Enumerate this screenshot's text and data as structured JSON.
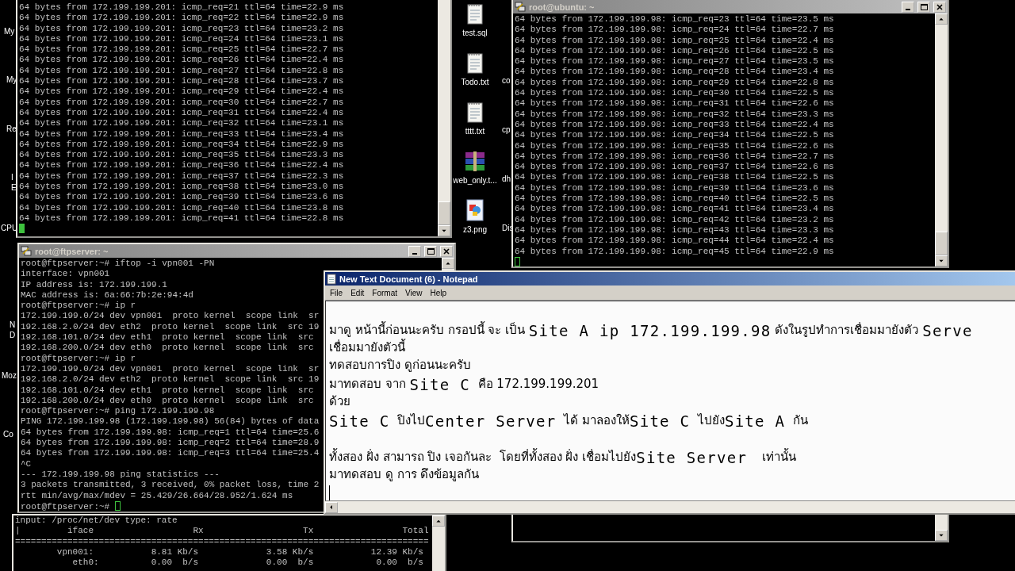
{
  "desktop": {
    "edge_labels": [
      {
        "text": "My"
      },
      {
        "text": "My"
      },
      {
        "text": "Re"
      },
      {
        "text": "I"
      },
      {
        "text": "E"
      },
      {
        "text": "CPU"
      },
      {
        "text": "N"
      },
      {
        "text": "D"
      },
      {
        "text": "Moz"
      },
      {
        "text": "Co"
      }
    ],
    "icons": [
      {
        "label": "test.sql",
        "kind": "text"
      },
      {
        "label": "Todo.txt",
        "kind": "text"
      },
      {
        "label": "tttt.txt",
        "kind": "text"
      },
      {
        "label": "web_only.t...",
        "kind": "archive"
      },
      {
        "label": "z3.png",
        "kind": "image"
      }
    ],
    "cut_labels": [
      "co",
      "cp",
      "dh",
      "Dis"
    ]
  },
  "top_left_terminal": {
    "lines": [
      "64 bytes from 172.199.199.201: icmp_req=21 ttl=64 time=22.9 ms",
      "64 bytes from 172.199.199.201: icmp_req=22 ttl=64 time=22.9 ms",
      "64 bytes from 172.199.199.201: icmp_req=23 ttl=64 time=23.2 ms",
      "64 bytes from 172.199.199.201: icmp_req=24 ttl=64 time=23.1 ms",
      "64 bytes from 172.199.199.201: icmp_req=25 ttl=64 time=22.7 ms",
      "64 bytes from 172.199.199.201: icmp_req=26 ttl=64 time=22.4 ms",
      "64 bytes from 172.199.199.201: icmp_req=27 ttl=64 time=22.8 ms",
      "64 bytes from 172.199.199.201: icmp_req=28 ttl=64 time=23.7 ms",
      "64 bytes from 172.199.199.201: icmp_req=29 ttl=64 time=22.4 ms",
      "64 bytes from 172.199.199.201: icmp_req=30 ttl=64 time=22.7 ms",
      "64 bytes from 172.199.199.201: icmp_req=31 ttl=64 time=22.4 ms",
      "64 bytes from 172.199.199.201: icmp_req=32 ttl=64 time=23.1 ms",
      "64 bytes from 172.199.199.201: icmp_req=33 ttl=64 time=23.4 ms",
      "64 bytes from 172.199.199.201: icmp_req=34 ttl=64 time=22.9 ms",
      "64 bytes from 172.199.199.201: icmp_req=35 ttl=64 time=23.3 ms",
      "64 bytes from 172.199.199.201: icmp_req=36 ttl=64 time=22.4 ms",
      "64 bytes from 172.199.199.201: icmp_req=37 ttl=64 time=22.3 ms",
      "64 bytes from 172.199.199.201: icmp_req=38 ttl=64 time=23.0 ms",
      "64 bytes from 172.199.199.201: icmp_req=39 ttl=64 time=23.6 ms",
      "64 bytes from 172.199.199.201: icmp_req=40 ttl=64 time=23.8 ms",
      "64 bytes from 172.199.199.201: icmp_req=41 ttl=64 time=22.8 ms"
    ]
  },
  "ubuntu_terminal": {
    "title": "root@ubuntu: ~",
    "lines": [
      "64 bytes from 172.199.199.98: icmp_req=23 ttl=64 time=23.5 ms",
      "64 bytes from 172.199.199.98: icmp_req=24 ttl=64 time=22.7 ms",
      "64 bytes from 172.199.199.98: icmp_req=25 ttl=64 time=22.4 ms",
      "64 bytes from 172.199.199.98: icmp_req=26 ttl=64 time=22.5 ms",
      "64 bytes from 172.199.199.98: icmp_req=27 ttl=64 time=23.5 ms",
      "64 bytes from 172.199.199.98: icmp_req=28 ttl=64 time=23.4 ms",
      "64 bytes from 172.199.199.98: icmp_req=29 ttl=64 time=22.8 ms",
      "64 bytes from 172.199.199.98: icmp_req=30 ttl=64 time=22.5 ms",
      "64 bytes from 172.199.199.98: icmp_req=31 ttl=64 time=22.6 ms",
      "64 bytes from 172.199.199.98: icmp_req=32 ttl=64 time=23.3 ms",
      "64 bytes from 172.199.199.98: icmp_req=33 ttl=64 time=22.4 ms",
      "64 bytes from 172.199.199.98: icmp_req=34 ttl=64 time=22.5 ms",
      "64 bytes from 172.199.199.98: icmp_req=35 ttl=64 time=22.6 ms",
      "64 bytes from 172.199.199.98: icmp_req=36 ttl=64 time=22.7 ms",
      "64 bytes from 172.199.199.98: icmp_req=37 ttl=64 time=22.6 ms",
      "64 bytes from 172.199.199.98: icmp_req=38 ttl=64 time=22.5 ms",
      "64 bytes from 172.199.199.98: icmp_req=39 ttl=64 time=23.6 ms",
      "64 bytes from 172.199.199.98: icmp_req=40 ttl=64 time=22.5 ms",
      "64 bytes from 172.199.199.98: icmp_req=41 ttl=64 time=23.4 ms",
      "64 bytes from 172.199.199.98: icmp_req=42 ttl=64 time=23.2 ms",
      "64 bytes from 172.199.199.98: icmp_req=43 ttl=64 time=23.3 ms",
      "64 bytes from 172.199.199.98: icmp_req=44 ttl=64 time=22.4 ms",
      "64 bytes from 172.199.199.98: icmp_req=45 ttl=64 time=22.9 ms"
    ]
  },
  "iftop_terminal": {
    "lines": [
      "input: /proc/net/dev type: rate",
      "|         iface                   Rx                   Tx                 Total",
      "===============================================================================",
      "        vpn001:           8.81 Kb/s             3.58 Kb/s           12.39 Kb/s",
      "           eth0:          0.00  b/s             0.00  b/s            0.00  b/s"
    ]
  },
  "ftpserver_terminal": {
    "title": "root@ftpserver: ~",
    "lines": [
      "root@ftpserver:~# iftop -i vpn001 -PN",
      "interface: vpn001",
      "IP address is: 172.199.199.1",
      "MAC address is: 6a:66:7b:2e:94:4d",
      "root@ftpserver:~# ip r",
      "172.199.199.0/24 dev vpn001  proto kernel  scope link  sr",
      "192.168.2.0/24 dev eth2  proto kernel  scope link  src 19",
      "192.168.101.0/24 dev eth1  proto kernel  scope link  src",
      "192.168.200.0/24 dev eth0  proto kernel  scope link  src",
      "root@ftpserver:~# ip r",
      "172.199.199.0/24 dev vpn001  proto kernel  scope link  sr",
      "192.168.2.0/24 dev eth2  proto kernel  scope link  src 19",
      "192.168.101.0/24 dev eth1  proto kernel  scope link  src",
      "192.168.200.0/24 dev eth0  proto kernel  scope link  src",
      "root@ftpserver:~# ping 172.199.199.98",
      "PING 172.199.199.98 (172.199.199.98) 56(84) bytes of data",
      "64 bytes from 172.199.199.98: icmp_req=1 ttl=64 time=25.6",
      "64 bytes from 172.199.199.98: icmp_req=2 ttl=64 time=28.9",
      "64 bytes from 172.199.199.98: icmp_req=3 ttl=64 time=25.4",
      "^C",
      "--- 172.199.199.98 ping statistics ---",
      "3 packets transmitted, 3 received, 0% packet loss, time 2",
      "rtt min/avg/max/mdev = 25.429/26.664/28.952/1.624 ms",
      "root@ftpserver:~# "
    ]
  },
  "notepad": {
    "title": "New Text Document (6) - Notepad",
    "menu": [
      "File",
      "Edit",
      "Format",
      "View",
      "Help"
    ],
    "lines": [
      {
        "kind": "text",
        "segments": [
          {
            "text": "มาดู หน้านี้ก่อนนะครับ กรอปนี้ จะ เป็น ",
            "kind": "thai"
          },
          {
            "text": "Site A ip 172.199.199.98",
            "kind": "mono"
          },
          {
            "text": " ดังในรูปทำการเชื่อมมายังตัว ",
            "kind": "thai"
          },
          {
            "text": "Serve",
            "kind": "mono"
          }
        ]
      },
      {
        "kind": "text",
        "segments": [
          {
            "text": "เชื่อมมายังตัวนี้",
            "kind": "thai"
          }
        ]
      },
      {
        "kind": "text",
        "segments": [
          {
            "text": "ทดสอบการปิง ดูก่อนนะครับ",
            "kind": "thai"
          }
        ]
      },
      {
        "kind": "text",
        "segments": [
          {
            "text": "มาทดสอบ จาก ",
            "kind": "thai"
          },
          {
            "text": "Site C",
            "kind": "mono"
          },
          {
            "text": "  คือ 172.199.199.201",
            "kind": "thai"
          }
        ]
      },
      {
        "kind": "text",
        "segments": [
          {
            "text": "ด้วย",
            "kind": "thai"
          }
        ]
      },
      {
        "kind": "text",
        "segments": [
          {
            "text": "Site C",
            "kind": "mono"
          },
          {
            "text": "  ปิงไป",
            "kind": "thai"
          },
          {
            "text": "Center Server",
            "kind": "mono"
          },
          {
            "text": "  ได้ มาลองให้",
            "kind": "thai"
          },
          {
            "text": "Site C",
            "kind": "mono"
          },
          {
            "text": "  ไปยัง",
            "kind": "thai"
          },
          {
            "text": "Site A",
            "kind": "mono"
          },
          {
            "text": "  กัน",
            "kind": "thai"
          }
        ]
      },
      {
        "kind": "blank"
      },
      {
        "kind": "text",
        "segments": [
          {
            "text": "ทั้งสอง ฝั่ง สามารถ ปิง เจอกันละ  โดยที่ทั้งสอง ฝั่ง เชื่อมไปยัง",
            "kind": "thai"
          },
          {
            "text": "Site Server",
            "kind": "mono"
          },
          {
            "text": "    เท่านั้น",
            "kind": "thai"
          }
        ]
      },
      {
        "kind": "text",
        "segments": [
          {
            "text": "มาทดสอบ ดู การ ดึงข้อมูลกัน",
            "kind": "thai"
          }
        ]
      }
    ]
  }
}
